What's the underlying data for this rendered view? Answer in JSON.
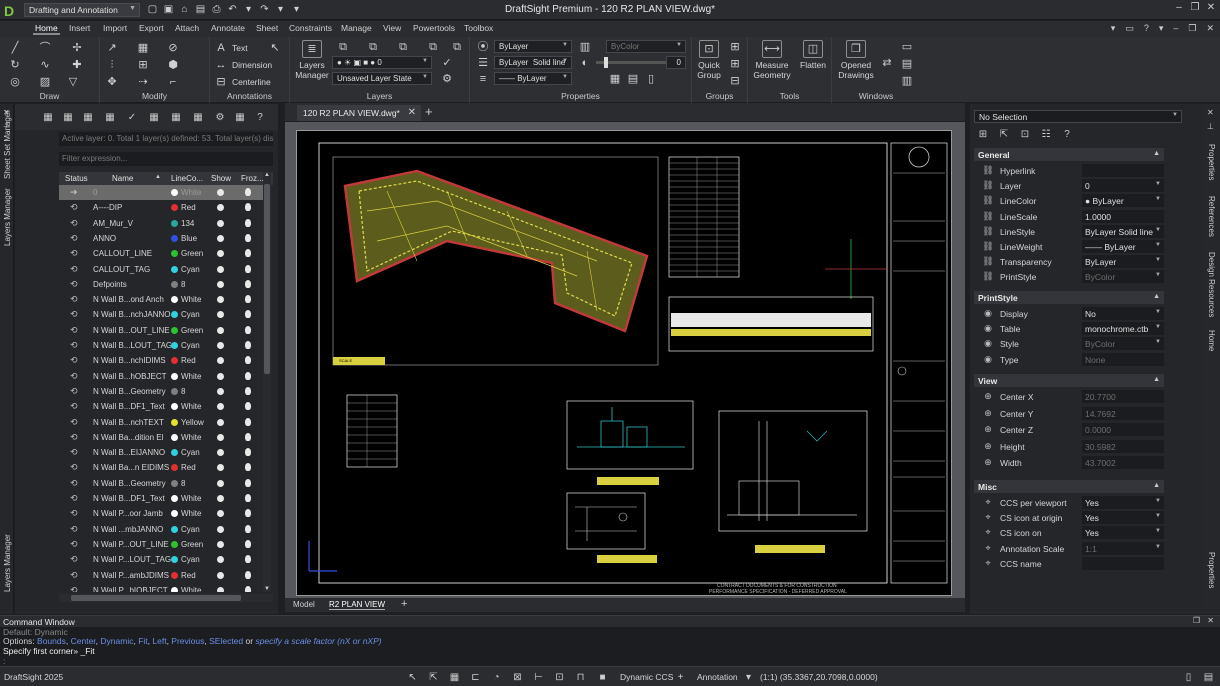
{
  "app": {
    "title": "DraftSight Premium - 120 R2 PLAN VIEW.dwg*",
    "workspace": "Drafting and Annotation"
  },
  "menu_tabs": [
    "Home",
    "Insert",
    "Import",
    "Export",
    "Attach",
    "Annotate",
    "Sheet",
    "Constraints",
    "Manage",
    "View",
    "Powertools",
    "Toolbox"
  ],
  "ribbon": {
    "groups": {
      "draw": "Draw",
      "modify": "Modify",
      "annotations": "Annotations",
      "layers": "Layers",
      "properties": "Properties",
      "groups": "Groups",
      "tools": "Tools",
      "windows": "Windows"
    },
    "annotations": {
      "text": "Text",
      "dimension": "Dimension",
      "centerline": "Centerline"
    },
    "layers": {
      "manager_label": "Layers Manager",
      "layer_value": "0",
      "layer_state": "Unsaved Layer State"
    },
    "properties": {
      "color_by_layer": "ByLayer",
      "color_by_color": "ByColor",
      "linestyle_by_layer": "ByLayer",
      "linestyle_value": "Solid line",
      "lineweight": "—— ByLayer",
      "transparency_value": "0"
    },
    "buttons": {
      "quick_group": "Quick Group",
      "measure_geometry": "Measure Geometry",
      "flatten": "Flatten",
      "opened_drawings": "Opened Drawings"
    }
  },
  "left_strip": {
    "sheet_set_manager": "Sheet Set Manager",
    "layers_manager": "Layers Manager",
    "layers_manager_bottom": "Layers Manager"
  },
  "layers_panel": {
    "active_info": "Active layer: 0. Total 1 layer(s) defined: 53. Total layer(s) display",
    "filter_placeholder": "Filter expression...",
    "columns": {
      "status": "Status",
      "name": "Name",
      "linecolor": "LineCo...",
      "show": "Show",
      "frozen": "Froz..."
    },
    "rows": [
      {
        "name": "0",
        "color": "White",
        "hex": "#ffffff"
      },
      {
        "name": "A----DIP",
        "color": "Red",
        "hex": "#e03030"
      },
      {
        "name": "AM_Mur_V",
        "color": "134",
        "hex": "#2aa59a"
      },
      {
        "name": "ANNO",
        "color": "Blue",
        "hex": "#3050e0"
      },
      {
        "name": "CALLOUT_LINE",
        "color": "Green",
        "hex": "#30c030"
      },
      {
        "name": "CALLOUT_TAG",
        "color": "Cyan",
        "hex": "#30d0e0"
      },
      {
        "name": "Defpoints",
        "color": "8",
        "hex": "#808080"
      },
      {
        "name": "N Wall B...ond Anch",
        "color": "White",
        "hex": "#ffffff"
      },
      {
        "name": "N Wall B...nchJANNO",
        "color": "Cyan",
        "hex": "#30d0e0"
      },
      {
        "name": "N Wall B...OUT_LINE",
        "color": "Green",
        "hex": "#30c030"
      },
      {
        "name": "N Wall B...LOUT_TAG",
        "color": "Cyan",
        "hex": "#30d0e0"
      },
      {
        "name": "N Wall B...nchIDIMS",
        "color": "Red",
        "hex": "#e03030"
      },
      {
        "name": "N Wall B...hOBJECT",
        "color": "White",
        "hex": "#ffffff"
      },
      {
        "name": "N Wall B...Geometry",
        "color": "8",
        "hex": "#808080"
      },
      {
        "name": "N Wall B...DF1_Text",
        "color": "White",
        "hex": "#ffffff"
      },
      {
        "name": "N Wall B...nchTEXT",
        "color": "Yellow",
        "hex": "#e8e030"
      },
      {
        "name": "N Wall Ba...dition El",
        "color": "White",
        "hex": "#ffffff"
      },
      {
        "name": "N Wall B...EIJANNO",
        "color": "Cyan",
        "hex": "#30d0e0"
      },
      {
        "name": "N Wall Ba...n EIDIMS",
        "color": "Red",
        "hex": "#e03030"
      },
      {
        "name": "N Wall B...Geometry",
        "color": "8",
        "hex": "#808080"
      },
      {
        "name": "N Wall B...DF1_Text",
        "color": "White",
        "hex": "#ffffff"
      },
      {
        "name": "N Wall P...oor Jamb",
        "color": "White",
        "hex": "#ffffff"
      },
      {
        "name": "N Wall ...mbJANNO",
        "color": "Cyan",
        "hex": "#30d0e0"
      },
      {
        "name": "N Wall P...OUT_LINE",
        "color": "Green",
        "hex": "#30c030"
      },
      {
        "name": "N Wall P...LOUT_TAG",
        "color": "Cyan",
        "hex": "#30d0e0"
      },
      {
        "name": "N Wall P...ambJDIMS",
        "color": "Red",
        "hex": "#e03030"
      },
      {
        "name": "N Wall P...bIOBJECT",
        "color": "White",
        "hex": "#ffffff"
      }
    ]
  },
  "document_tab": {
    "title": "120 R2 PLAN VIEW.dwg*"
  },
  "layout_tabs": {
    "model": "Model",
    "active": "R2 PLAN VIEW"
  },
  "right_strip": {
    "properties": "Properties",
    "references": "References",
    "design_resources": "Design Resources",
    "home": "Home",
    "properties_bottom": "Properties"
  },
  "properties_panel": {
    "selection": "No Selection",
    "sections": {
      "general": "General",
      "printstyle": "PrintStyle",
      "view": "View",
      "misc": "Misc"
    },
    "general": [
      {
        "label": "Hyperlink",
        "value": "",
        "dim": false,
        "dropdown": false
      },
      {
        "label": "Layer",
        "value": "0",
        "dim": false,
        "dropdown": true
      },
      {
        "label": "LineColor",
        "value": "● ByLayer",
        "dim": false,
        "dropdown": true
      },
      {
        "label": "LineScale",
        "value": "1.0000",
        "dim": false,
        "dropdown": false
      },
      {
        "label": "LineStyle",
        "value": "ByLayer    Solid line",
        "dim": false,
        "dropdown": true
      },
      {
        "label": "LineWeight",
        "value": "—— ByLayer",
        "dim": false,
        "dropdown": true
      },
      {
        "label": "Transparency",
        "value": "ByLayer",
        "dim": false,
        "dropdown": true
      },
      {
        "label": "PrintStyle",
        "value": "ByColor",
        "dim": true,
        "dropdown": true
      }
    ],
    "printstyle": [
      {
        "label": "Display",
        "value": "No",
        "dim": false,
        "dropdown": true
      },
      {
        "label": "Table",
        "value": "monochrome.ctb",
        "dim": false,
        "dropdown": true
      },
      {
        "label": "Style",
        "value": "ByColor",
        "dim": true,
        "dropdown": true
      },
      {
        "label": "Type",
        "value": "None",
        "dim": true,
        "dropdown": false
      }
    ],
    "view": [
      {
        "label": "Center X",
        "value": "20.7700",
        "dim": true,
        "dropdown": false
      },
      {
        "label": "Center Y",
        "value": "14.7692",
        "dim": true,
        "dropdown": false
      },
      {
        "label": "Center Z",
        "value": "0.0000",
        "dim": true,
        "dropdown": false
      },
      {
        "label": "Height",
        "value": "30.5982",
        "dim": true,
        "dropdown": false
      },
      {
        "label": "Width",
        "value": "43.7002",
        "dim": true,
        "dropdown": false
      }
    ],
    "misc": [
      {
        "label": "CCS per viewport",
        "value": "Yes",
        "dim": false,
        "dropdown": true
      },
      {
        "label": "CS icon at origin",
        "value": "Yes",
        "dim": false,
        "dropdown": true
      },
      {
        "label": "CS icon on",
        "value": "Yes",
        "dim": false,
        "dropdown": true
      },
      {
        "label": "Annotation Scale",
        "value": "1:1",
        "dim": true,
        "dropdown": true
      },
      {
        "label": "CCS name",
        "value": "",
        "dim": false,
        "dropdown": false
      }
    ]
  },
  "command_window": {
    "title": "Command Window",
    "line1": "Default: Dynamic",
    "options_prefix": "Options:",
    "options": [
      "Bounds",
      "Center",
      "Dynamic",
      "Fit",
      "Left",
      "Previous",
      "SElected"
    ],
    "options_or": "or",
    "options_hint": "specify a scale factor (nX or nXP)",
    "prompt": "Specify first corner» _Fit"
  },
  "drawing": {
    "scale_tag": "SCALE",
    "footer_line1": "CONTRACT DOCUMENTS & FOR CONSTRUCTION",
    "footer_line2": "PERFORMANCE SPECIFICATION - DEFERRED APPROVAL"
  },
  "statusbar": {
    "app_version": "DraftSight 2025",
    "ccs": "Dynamic CCS",
    "annotation": "Annotation",
    "coords": "(1:1)  (35.3367,20.7098,0.0000)"
  }
}
